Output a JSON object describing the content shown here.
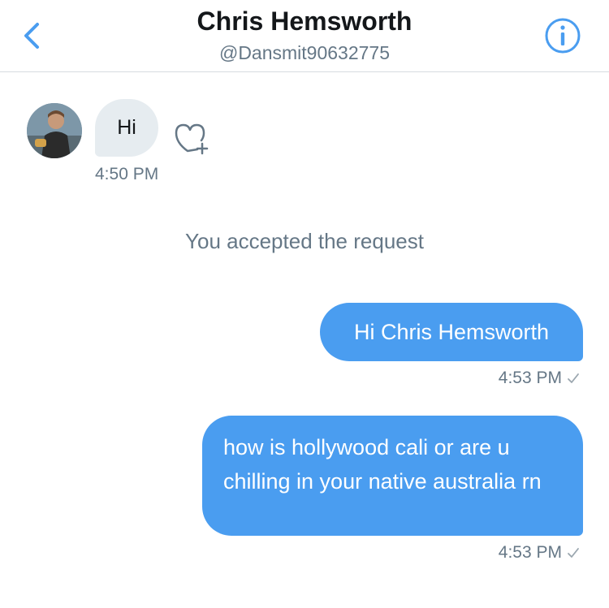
{
  "header": {
    "title": "Chris Hemsworth",
    "handle": "@Dansmit90632775"
  },
  "messages": {
    "incoming": [
      {
        "text": "Hi",
        "time": "4:50 PM"
      }
    ],
    "system": "You accepted the request",
    "outgoing": [
      {
        "text": "Hi Chris Hemsworth",
        "time": "4:53 PM"
      },
      {
        "text": "how is hollywood cali or are u chilling in your native australia rn",
        "time": "4:53 PM"
      }
    ]
  },
  "icons": {
    "back": "chevron-left-icon",
    "info": "info-icon",
    "react": "heart-plus-icon",
    "sent": "checkmark-icon"
  },
  "colors": {
    "accent": "#4a9df0",
    "incoming_bubble": "#e6ecf0",
    "secondary_text": "#657786"
  }
}
